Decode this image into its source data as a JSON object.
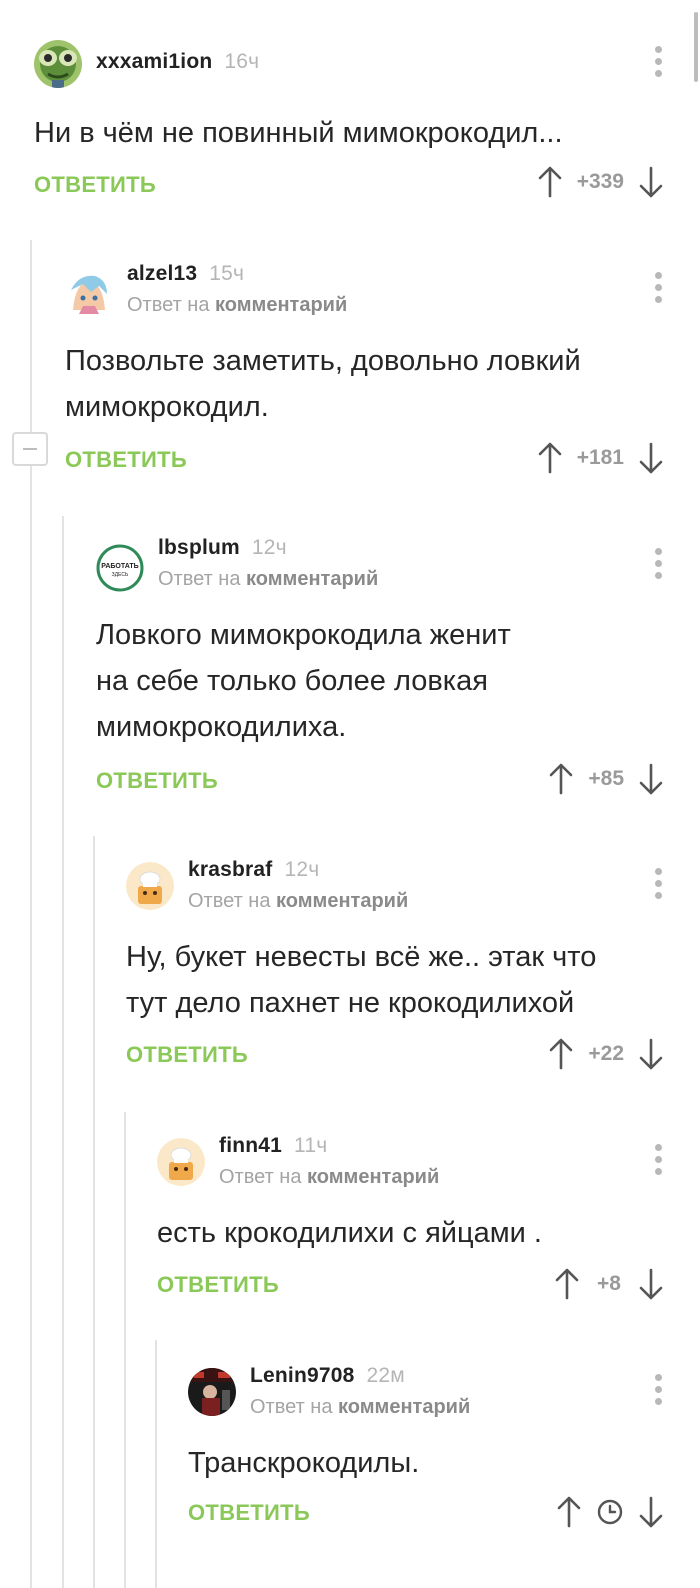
{
  "comments": [
    {
      "username": "xxxami1ion",
      "time": "16ч",
      "reply_prefix": "",
      "reply_link": "",
      "text_lines": [
        "Ни в чём не повинный мимокрокодил..."
      ],
      "reply_label": "ОТВЕТИТЬ",
      "score": "+339",
      "avatar": "chameleon-avatar"
    },
    {
      "username": "alzel13",
      "time": "15ч",
      "reply_prefix": "Ответ на ",
      "reply_link": "комментарий",
      "text_lines": [
        "Позвольте заметить, довольно ловкий",
        "мимокрокодил."
      ],
      "reply_label": "ОТВЕТИТЬ",
      "score": "+181",
      "avatar": "anime-avatar"
    },
    {
      "username": "lbsplum",
      "time": "12ч",
      "reply_prefix": "Ответ на ",
      "reply_link": "комментарий",
      "text_lines": [
        "Ловкого мимокрокодила женит",
        "на себе только более ловкая",
        "мимокрокодилиха."
      ],
      "reply_label": "ОТВЕТИТЬ",
      "score": "+85",
      "avatar": "badge-avatar",
      "avatar_text": [
        "РАБОТАТЬ",
        "ЗДЕСЬ"
      ]
    },
    {
      "username": "krasbraf",
      "time": "12ч",
      "reply_prefix": "Ответ на ",
      "reply_link": "комментарий",
      "text_lines": [
        "Ну, букет невесты всё же.. этак что",
        "тут дело пахнет не крокодилихой"
      ],
      "reply_label": "ОТВЕТИТЬ",
      "score": "+22",
      "avatar": "chef-avatar"
    },
    {
      "username": "finn41",
      "time": "11ч",
      "reply_prefix": "Ответ на ",
      "reply_link": "комментарий",
      "text_lines": [
        "есть крокодилихи с яйцами ."
      ],
      "reply_label": "ОТВЕТИТЬ",
      "score": "+8",
      "avatar": "chef-avatar"
    },
    {
      "username": "Lenin9708",
      "time": "22м",
      "reply_prefix": "Ответ на ",
      "reply_link": "комментарий",
      "text_lines": [
        "Транскрокодилы."
      ],
      "reply_label": "ОТВЕТИТЬ",
      "score": "",
      "score_icon": "clock-icon",
      "avatar": "photo-avatar"
    }
  ],
  "colors": {
    "accent_green": "#8ac858",
    "thread_line": "#e3e3e3",
    "muted_text": "#a4a4a4"
  },
  "icons": {
    "upvote": "arrow-up-icon",
    "downvote": "arrow-down-icon",
    "menu": "more-vertical-icon",
    "collapse": "minus-box-icon",
    "pending_score": "clock-icon"
  }
}
